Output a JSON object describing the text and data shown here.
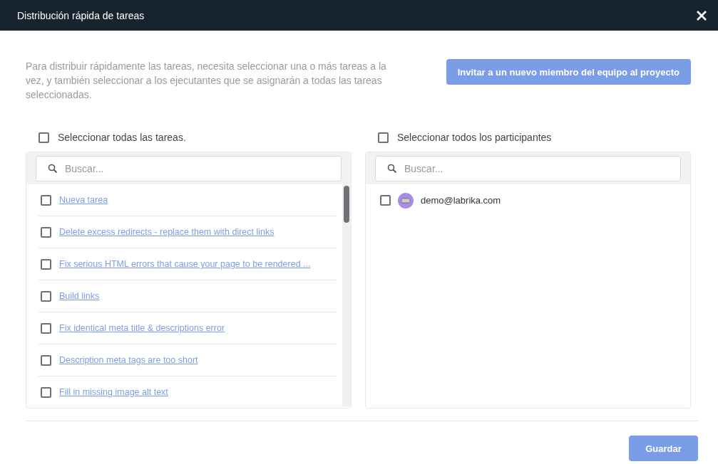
{
  "window": {
    "title": "Distribución rápida de tareas"
  },
  "intro": "Para distribuir rápidamente las tareas, necesita seleccionar una o más tareas a la vez, y también seleccionar a los ejecutantes que se asignarán a todas las tareas seleccionadas.",
  "invite_button": "Invitar a un nuevo miembro del equipo al proyecto",
  "tasks_panel": {
    "select_all": {
      "label": "Seleccionar todas las tareas.",
      "checked": false
    },
    "search": {
      "placeholder": "Buscar..."
    },
    "items": [
      {
        "title": "Nueva tarea",
        "checked": false
      },
      {
        "title": "Delete excess redirects - replace them with direct links",
        "checked": false
      },
      {
        "title": "Fix serious HTML errors that cause your page to be rendered ...",
        "checked": false
      },
      {
        "title": "Build links",
        "checked": false
      },
      {
        "title": "Fix identical meta title & descriptions error",
        "checked": false
      },
      {
        "title": "Description meta tags are too short",
        "checked": false
      },
      {
        "title": "Fill in missing image alt text",
        "checked": false
      }
    ]
  },
  "members_panel": {
    "select_all": {
      "label": "Seleccionar todos los participantes",
      "checked": false
    },
    "search": {
      "placeholder": "Buscar..."
    },
    "items": [
      {
        "email": "demo@labrika.com",
        "checked": false
      }
    ]
  },
  "save_button": "Guardar"
}
